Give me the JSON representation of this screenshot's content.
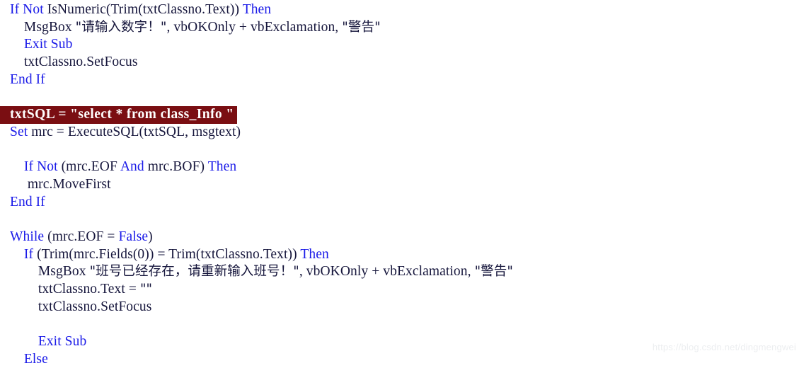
{
  "editor": {
    "language": "Visual Basic",
    "colors": {
      "background": "#ffffff",
      "keyword": "#1a1ae8",
      "identifier": "#16163c",
      "highlight_background": "#7a0e12",
      "highlight_text": "#ffffff",
      "watermark": "#eceef0"
    },
    "lines": [
      {
        "n": 1,
        "indent": 0,
        "text": "If Not IsNumeric(Trim(txtClassno.Text)) Then",
        "segments": [
          {
            "t": "If Not ",
            "k": true
          },
          {
            "t": "IsNumeric(Trim(txtClassno.Text)) ",
            "k": false
          },
          {
            "t": "Then",
            "k": true
          }
        ]
      },
      {
        "n": 2,
        "indent": 1,
        "text": "MsgBox \"请输入数字！\", vbOKOnly + vbExclamation, \"警告\"",
        "segments": [
          {
            "t": "MsgBox ",
            "k": false
          },
          {
            "t": "\"请输入数字！\"",
            "k": false,
            "cjk": true
          },
          {
            "t": ", vbOKOnly + vbExclamation, ",
            "k": false
          },
          {
            "t": "\"警告\"",
            "k": false,
            "cjk": true
          }
        ]
      },
      {
        "n": 3,
        "indent": 1,
        "text": "Exit Sub",
        "segments": [
          {
            "t": "Exit Sub",
            "k": true
          }
        ]
      },
      {
        "n": 4,
        "indent": 1,
        "text": "txtClassno.SetFocus",
        "segments": [
          {
            "t": "txtClassno.SetFocus",
            "k": false
          }
        ]
      },
      {
        "n": 5,
        "indent": 0,
        "text": "End If",
        "segments": [
          {
            "t": "End If",
            "k": true
          }
        ]
      },
      {
        "n": 6,
        "indent": 0,
        "text": "",
        "blank": true,
        "segments": []
      },
      {
        "n": 7,
        "indent": 0,
        "highlighted": true,
        "text": "txtSQL = \"select * from class_Info \"",
        "segments": [
          {
            "t": "txtSQL = \"select * from class_Info \"",
            "k": false
          }
        ]
      },
      {
        "n": 8,
        "indent": 0,
        "text": "Set mrc = ExecuteSQL(txtSQL, msgtext)",
        "segments": [
          {
            "t": "Set ",
            "k": true
          },
          {
            "t": "mrc = ExecuteSQL(txtSQL, msgtext)",
            "k": false
          }
        ]
      },
      {
        "n": 9,
        "indent": 0,
        "text": "",
        "blank": true,
        "segments": []
      },
      {
        "n": 10,
        "indent": 1,
        "text": "If Not (mrc.EOF And mrc.BOF) Then",
        "segments": [
          {
            "t": "If Not ",
            "k": true
          },
          {
            "t": "(mrc.EOF ",
            "k": false
          },
          {
            "t": "And ",
            "k": true
          },
          {
            "t": "mrc.BOF) ",
            "k": false
          },
          {
            "t": "Then",
            "k": true
          }
        ]
      },
      {
        "n": 11,
        "indent": 1,
        "text": "mrc.MoveFirst",
        "segments": [
          {
            "t": " mrc.MoveFirst",
            "k": false
          }
        ]
      },
      {
        "n": 12,
        "indent": 0,
        "text": "End If",
        "segments": [
          {
            "t": "End If",
            "k": true
          }
        ]
      },
      {
        "n": 13,
        "indent": 0,
        "text": "",
        "blank": true,
        "segments": []
      },
      {
        "n": 14,
        "indent": 0,
        "text": "While (mrc.EOF = False)",
        "segments": [
          {
            "t": "While ",
            "k": true
          },
          {
            "t": "(mrc.EOF = ",
            "k": false
          },
          {
            "t": "False",
            "k": true
          },
          {
            "t": ")",
            "k": false
          }
        ]
      },
      {
        "n": 15,
        "indent": 1,
        "text": "If (Trim(mrc.Fields(0)) = Trim(txtClassno.Text)) Then",
        "segments": [
          {
            "t": "If ",
            "k": true
          },
          {
            "t": "(Trim(mrc.Fields(0)) = Trim(txtClassno.Text)) ",
            "k": false
          },
          {
            "t": "Then",
            "k": true
          }
        ]
      },
      {
        "n": 16,
        "indent": 2,
        "text": "MsgBox \"班号已经存在，请重新输入班号！\", vbOKOnly + vbExclamation, \"警告\"",
        "segments": [
          {
            "t": "MsgBox ",
            "k": false
          },
          {
            "t": "\"班号已经存在，请重新输入班号！\"",
            "k": false,
            "cjk": true
          },
          {
            "t": ", vbOKOnly + vbExclamation, ",
            "k": false
          },
          {
            "t": "\"警告\"",
            "k": false,
            "cjk": true
          }
        ]
      },
      {
        "n": 17,
        "indent": 2,
        "text": "txtClassno.Text = \"\"",
        "segments": [
          {
            "t": "txtClassno.Text = ",
            "k": false
          },
          {
            "t": "\"\"",
            "k": false,
            "cjk": true
          }
        ]
      },
      {
        "n": 18,
        "indent": 2,
        "text": "txtClassno.SetFocus",
        "segments": [
          {
            "t": "txtClassno.SetFocus",
            "k": false
          }
        ]
      },
      {
        "n": 19,
        "indent": 0,
        "text": "",
        "blank": true,
        "segments": []
      },
      {
        "n": 20,
        "indent": 2,
        "text": "Exit Sub",
        "segments": [
          {
            "t": "Exit Sub",
            "k": true
          }
        ]
      },
      {
        "n": 21,
        "indent": 1,
        "text": "Else",
        "segments": [
          {
            "t": "Else",
            "k": true
          }
        ]
      }
    ]
  },
  "watermark": {
    "text": "https://blog.csdn.net/dingmengwei"
  }
}
